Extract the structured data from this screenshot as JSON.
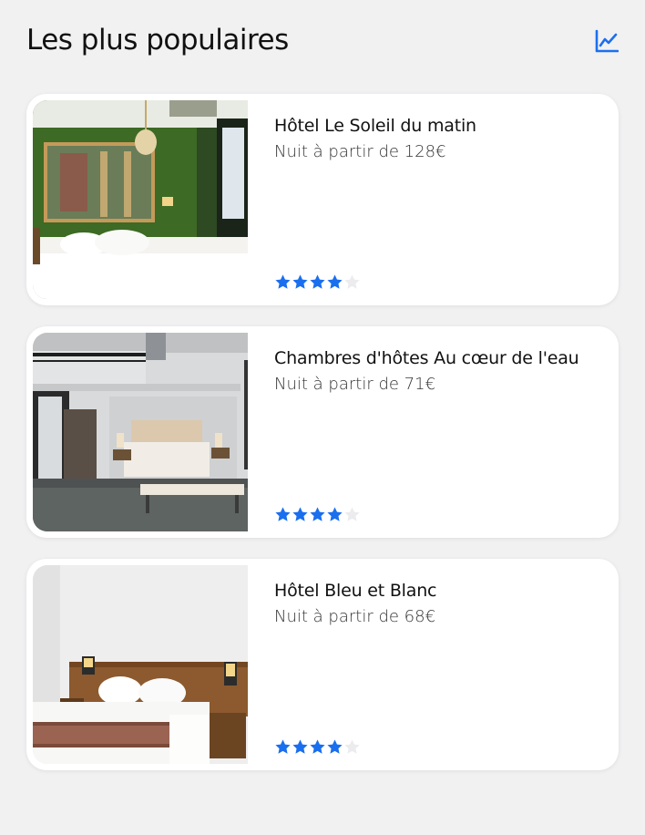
{
  "header": {
    "title": "Les plus populaires",
    "trend_icon": "chart-line-icon"
  },
  "colors": {
    "accent": "#1a6fef",
    "star_off": "#ececef",
    "background": "#f1f1f2"
  },
  "hotels": [
    {
      "name": "Hôtel Le Soleil du matin",
      "price": "Nuit à partir de 128€",
      "rating": 4,
      "max_rating": 5
    },
    {
      "name": "Chambres d'hôtes Au cœur de l'eau",
      "price": "Nuit à partir de 71€",
      "rating": 4,
      "max_rating": 5
    },
    {
      "name": "Hôtel Bleu et Blanc",
      "price": "Nuit à partir de 68€",
      "rating": 4,
      "max_rating": 5
    }
  ]
}
